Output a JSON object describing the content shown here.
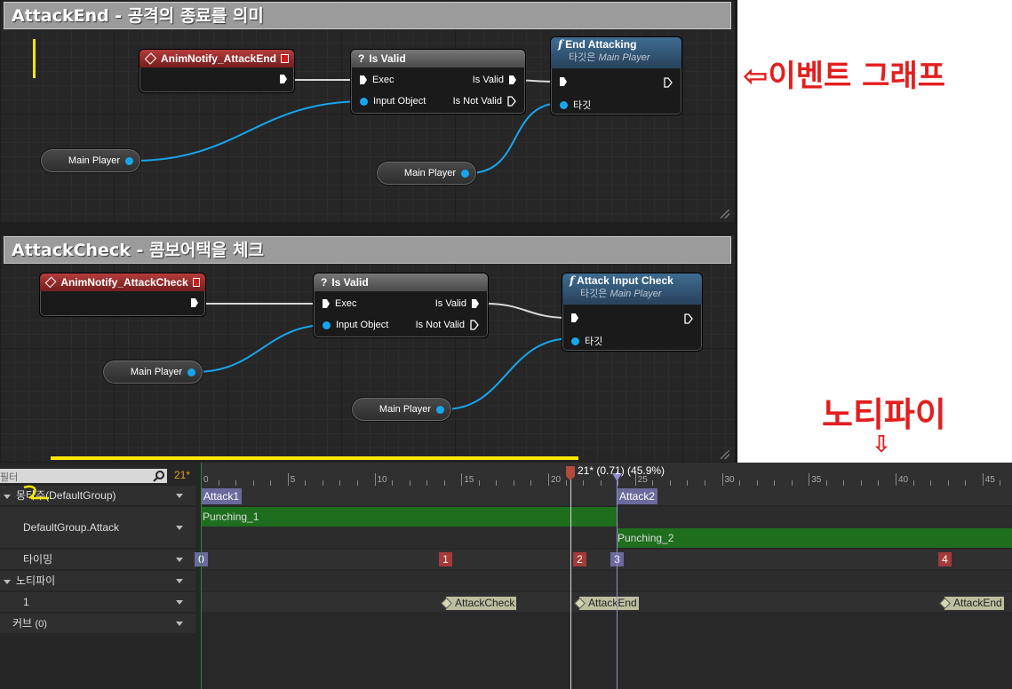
{
  "graph1": {
    "title": "AttackEnd - 공격의 종료를 의미",
    "event_node": {
      "label": "AnimNotify_AttackEnd"
    },
    "isvalid_node": {
      "title": "Is Valid",
      "exec": "Exec",
      "input": "Input Object",
      "is_valid": "Is Valid",
      "is_not_valid": "Is Not Valid"
    },
    "func_node": {
      "title": "End Attacking",
      "sub_prefix": "타깃은",
      "sub_target": "Main Player",
      "target_pin": "타깃"
    },
    "var1": "Main Player",
    "var2": "Main Player"
  },
  "graph2": {
    "title": "AttackCheck - 콤보어택을 체크",
    "event_node": {
      "label": "AnimNotify_AttackCheck"
    },
    "isvalid_node": {
      "title": "Is Valid",
      "exec": "Exec",
      "input": "Input Object",
      "is_valid": "Is Valid",
      "is_not_valid": "Is Not Valid"
    },
    "func_node": {
      "title": "Attack Input Check",
      "sub_prefix": "타깃은",
      "sub_target": "Main Player",
      "target_pin": "타깃"
    },
    "var1": "Main Player",
    "var2": "Main Player"
  },
  "annotations": {
    "event_graph": "⇦이벤트 그래프",
    "notify": "노티파이",
    "notify_arrow": "⇩"
  },
  "timeline": {
    "filter_placeholder": "필터",
    "current_frame": "21*",
    "scrubber_label": "21* (0.71) (45.9%)",
    "ticks": [
      "0",
      "5",
      "10",
      "15",
      "20",
      "25",
      "30",
      "35",
      "40",
      "45"
    ],
    "rows": {
      "montage": "몽타주(DefaultGroup)",
      "slot": "DefaultGroup.Attack",
      "timing": "타이밍",
      "notifies": "노티파이",
      "notify_track": "1",
      "curves": "커브",
      "curves_count": "(0)"
    },
    "sections": [
      "Attack1",
      "Attack2"
    ],
    "segments": [
      "Punching_1",
      "Punching_2"
    ],
    "timing_markers": [
      "0",
      "1",
      "2",
      "3",
      "4"
    ],
    "notifies": [
      "AttackCheck",
      "AttackEnd",
      "AttackEnd"
    ]
  },
  "colors": {
    "accent_red": "#e31e1e",
    "pin_blue": "#17a6ee",
    "segment_green": "#1e6e1e",
    "highlight_yellow": "#ffe800"
  }
}
